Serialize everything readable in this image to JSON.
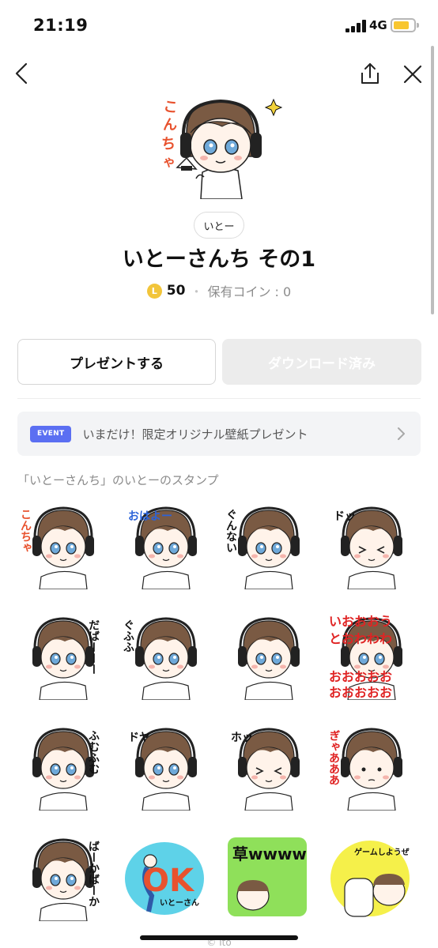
{
  "status_bar": {
    "time": "21:19",
    "network": "4G"
  },
  "product": {
    "author": "いとー",
    "title": "いとーさんち その1",
    "coin_symbol": "L",
    "price": "50",
    "separator": "・",
    "owned_coins": "保有コイン : 0"
  },
  "buttons": {
    "present": "プレゼントする",
    "download": "ダウンロード済み"
  },
  "event": {
    "badge": "EVENT",
    "text": "いまだけ！限定オリジナル壁紙プレゼント"
  },
  "section": {
    "label": "「いとーさんち」のいとーのスタンプ"
  },
  "stickers": [
    {
      "caption": "こんちゃ",
      "color": "#e8522e"
    },
    {
      "caption": "おはよー",
      "color": "#2b63d9"
    },
    {
      "caption": "ぐんない",
      "color": "#111111"
    },
    {
      "caption": "ドッ",
      "color": "#111111"
    },
    {
      "caption": "だばーーー",
      "color": "#111111"
    },
    {
      "caption": "ぐふふ",
      "color": "#111111"
    },
    {
      "caption": "",
      "color": "#111111"
    },
    {
      "caption": "いおおおお",
      "color": "#e02424"
    },
    {
      "caption": "ふむふむ",
      "color": "#111111"
    },
    {
      "caption": "ドヤ",
      "color": "#111111"
    },
    {
      "caption": "ホッ",
      "color": "#111111"
    },
    {
      "caption": "ぎゃあああ",
      "color": "#e02424"
    },
    {
      "caption": "ばーかばーか",
      "color": "#111111"
    },
    {
      "caption": "OK",
      "color": "#e8522e"
    },
    {
      "caption": "草wwww",
      "color": "#111111"
    },
    {
      "caption": "ゲームしようぜ",
      "color": "#111111"
    }
  ],
  "sticker_extras": {
    "ok_sub": "いとーさん"
  },
  "footer": {
    "copyright": "© Ito"
  },
  "colors": {
    "accent": "#5b6ff2",
    "coin": "#f2c53a",
    "battery": "#f8c630"
  }
}
